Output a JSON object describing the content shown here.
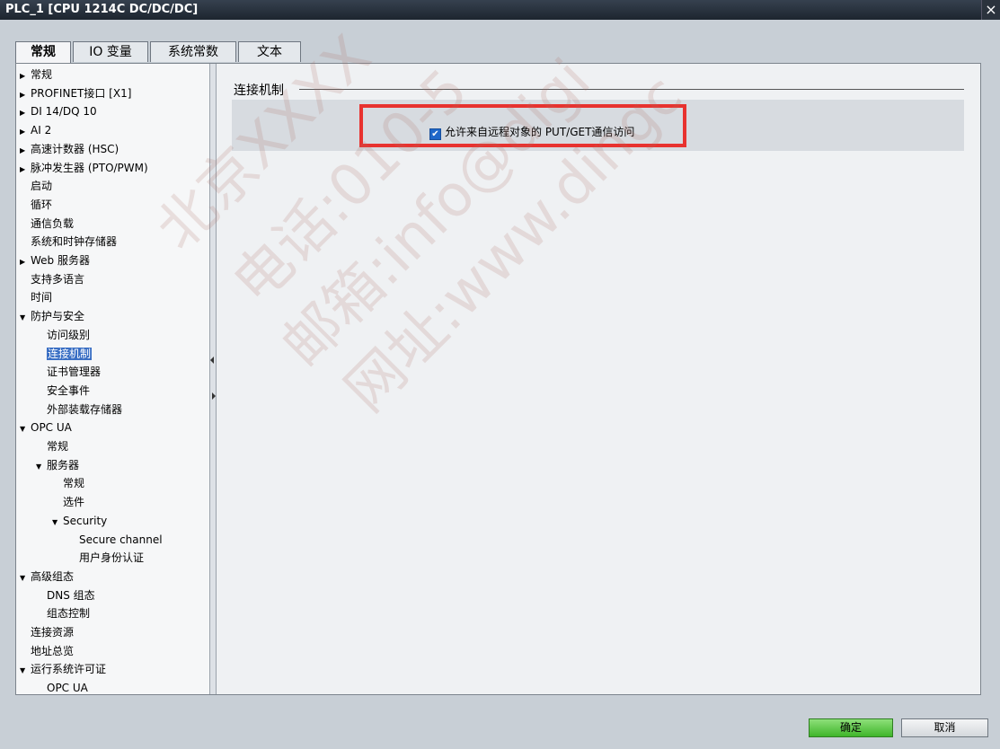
{
  "window": {
    "title": "PLC_1 [CPU 1214C DC/DC/DC]",
    "close_glyph": "×"
  },
  "tabs": [
    {
      "label": "常规",
      "active": true
    },
    {
      "label": "IO 变量",
      "active": false
    },
    {
      "label": "系统常数",
      "active": false
    },
    {
      "label": "文本",
      "active": false
    }
  ],
  "tree": {
    "items": [
      {
        "label": "常规",
        "arrow": "▶",
        "depth": 0
      },
      {
        "label": "PROFINET接口 [X1]",
        "arrow": "▶",
        "depth": 0
      },
      {
        "label": "DI 14/DQ 10",
        "arrow": "▶",
        "depth": 0
      },
      {
        "label": "AI 2",
        "arrow": "▶",
        "depth": 0
      },
      {
        "label": "高速计数器 (HSC)",
        "arrow": "▶",
        "depth": 0
      },
      {
        "label": "脉冲发生器 (PTO/PWM)",
        "arrow": "▶",
        "depth": 0
      },
      {
        "label": "启动",
        "arrow": "",
        "depth": 0
      },
      {
        "label": "循环",
        "arrow": "",
        "depth": 0
      },
      {
        "label": "通信负载",
        "arrow": "",
        "depth": 0
      },
      {
        "label": "系统和时钟存储器",
        "arrow": "",
        "depth": 0
      },
      {
        "label": "Web 服务器",
        "arrow": "▶",
        "depth": 0
      },
      {
        "label": "支持多语言",
        "arrow": "",
        "depth": 0
      },
      {
        "label": "时间",
        "arrow": "",
        "depth": 0
      },
      {
        "label": "防护与安全",
        "arrow": "▼",
        "depth": 0
      },
      {
        "label": "访问级别",
        "arrow": "",
        "depth": 1
      },
      {
        "label": "连接机制",
        "arrow": "",
        "depth": 1,
        "selected": true
      },
      {
        "label": "证书管理器",
        "arrow": "",
        "depth": 1
      },
      {
        "label": "安全事件",
        "arrow": "",
        "depth": 1
      },
      {
        "label": "外部装载存储器",
        "arrow": "",
        "depth": 1
      },
      {
        "label": "OPC UA",
        "arrow": "▼",
        "depth": 0
      },
      {
        "label": "常规",
        "arrow": "",
        "depth": 1
      },
      {
        "label": "服务器",
        "arrow": "▼",
        "depth": 1
      },
      {
        "label": "常规",
        "arrow": "",
        "depth": 2
      },
      {
        "label": "选件",
        "arrow": "",
        "depth": 2
      },
      {
        "label": "Security",
        "arrow": "▼",
        "depth": 2
      },
      {
        "label": "Secure channel",
        "arrow": "",
        "depth": 3
      },
      {
        "label": "用户身份认证",
        "arrow": "",
        "depth": 3
      },
      {
        "label": "高级组态",
        "arrow": "▼",
        "depth": 0
      },
      {
        "label": "DNS 组态",
        "arrow": "",
        "depth": 1
      },
      {
        "label": "组态控制",
        "arrow": "",
        "depth": 1
      },
      {
        "label": "连接资源",
        "arrow": "",
        "depth": 0
      },
      {
        "label": "地址总览",
        "arrow": "",
        "depth": 0
      },
      {
        "label": "运行系统许可证",
        "arrow": "▼",
        "depth": 0
      },
      {
        "label": "OPC UA",
        "arrow": "",
        "depth": 1
      }
    ]
  },
  "content": {
    "section_title": "连接机制",
    "checkbox_label": "允许来自远程对象的 PUT/GET通信访问",
    "checkbox_checked": true,
    "checkbox_glyph": "✔"
  },
  "buttons": {
    "ok": "确定",
    "cancel": "取消"
  },
  "watermark": [
    "北京XXXX",
    "电话:010-5",
    "邮箱:info@digi",
    "网址:www.dingc"
  ],
  "colors": {
    "selected": "#3a6fc4",
    "highlight_box": "#e8322f",
    "ok_button": "#3fb52a"
  }
}
